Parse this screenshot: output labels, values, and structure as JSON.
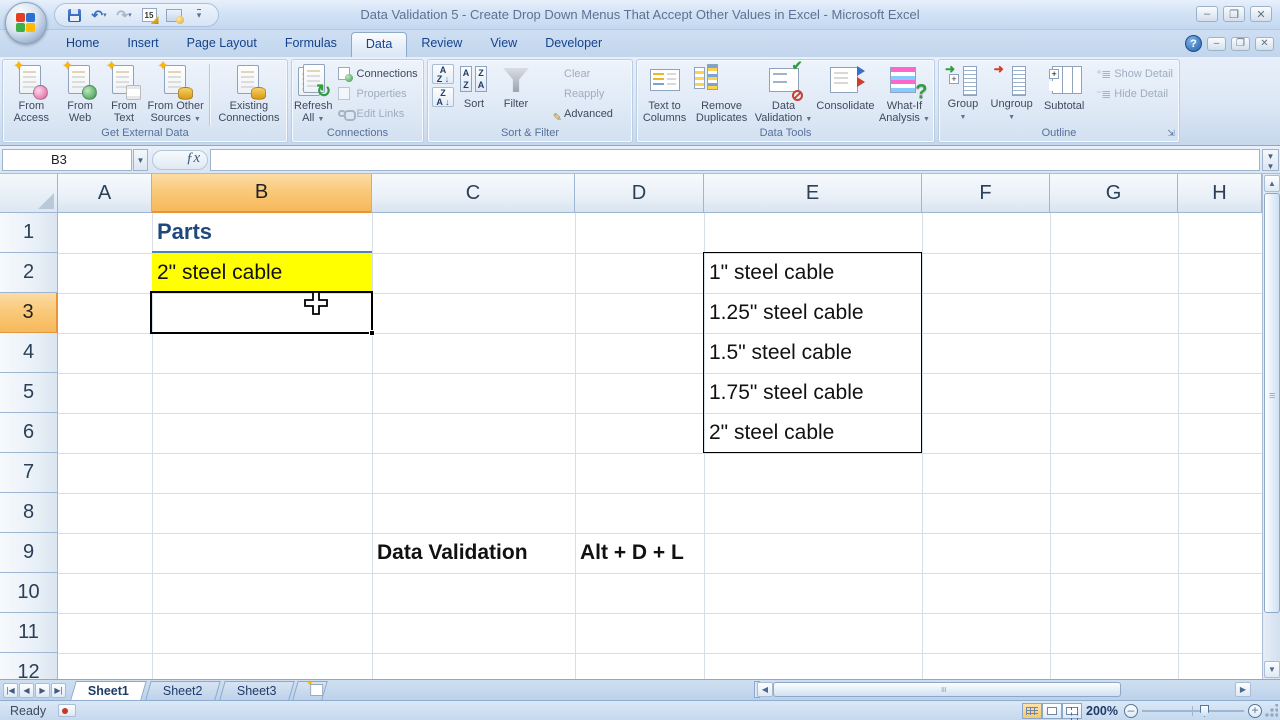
{
  "title_bar": {
    "title": "Data Validation 5 - Create Drop Down Menus That Accept Other Values in Excel - Microsoft Excel",
    "quick_access_icons": [
      "office-orb",
      "save",
      "undo",
      "redo",
      "autoformat",
      "table-style",
      "customize"
    ]
  },
  "ribbon_tabs": {
    "items": [
      "Home",
      "Insert",
      "Page Layout",
      "Formulas",
      "Data",
      "Review",
      "View",
      "Developer"
    ],
    "active": "Data"
  },
  "ribbon": {
    "groups": [
      {
        "name": "Get External Data",
        "buttons": [
          "From Access",
          "From Web",
          "From Text",
          "From Other Sources",
          "Existing Connections"
        ]
      },
      {
        "name": "Connections",
        "big_button": "Refresh All",
        "items": [
          "Connections",
          "Properties",
          "Edit Links"
        ],
        "disabled_items": [
          "Properties",
          "Edit Links"
        ]
      },
      {
        "name": "Sort & Filter",
        "big_buttons": [
          "Sort",
          "Filter"
        ],
        "items": [
          "Clear",
          "Reapply",
          "Advanced"
        ],
        "disabled_items": [
          "Clear",
          "Reapply"
        ]
      },
      {
        "name": "Data Tools",
        "buttons": [
          "Text to Columns",
          "Remove Duplicates",
          "Data Validation",
          "Consolidate",
          "What-If Analysis"
        ]
      },
      {
        "name": "Outline",
        "buttons": [
          "Group",
          "Ungroup",
          "Subtotal"
        ],
        "items": [
          "Show Detail",
          "Hide Detail"
        ],
        "disabled_items": [
          "Show Detail",
          "Hide Detail"
        ]
      }
    ]
  },
  "formula_bar": {
    "name_box": "B3",
    "fx_label": "ƒx",
    "input_value": ""
  },
  "grid": {
    "column_headers": [
      "A",
      "B",
      "C",
      "D",
      "E",
      "F",
      "G",
      "H"
    ],
    "row_headers": [
      "1",
      "2",
      "3",
      "4",
      "5",
      "6",
      "7",
      "8",
      "9",
      "10",
      "11",
      "12"
    ],
    "selected_cell": "B3",
    "selected_column": "B",
    "selected_row": "3",
    "cells": [
      {
        "ref": "B1",
        "text": "Parts",
        "style": "heading"
      },
      {
        "ref": "B2",
        "text": "2\" steel cable",
        "style": "yellow"
      },
      {
        "ref": "E2",
        "text": "1\" steel cable",
        "style": "plain"
      },
      {
        "ref": "E3",
        "text": "1.25\" steel cable",
        "style": "plain"
      },
      {
        "ref": "E4",
        "text": "1.5\" steel cable",
        "style": "plain"
      },
      {
        "ref": "E5",
        "text": "1.75\" steel cable",
        "style": "plain"
      },
      {
        "ref": "E6",
        "text": "2\" steel cable",
        "style": "plain"
      },
      {
        "ref": "C9",
        "text": "Data Validation",
        "style": "bold"
      },
      {
        "ref": "D9",
        "text": "Alt + D + L",
        "style": "bold"
      }
    ],
    "bordered_range": "E2:E6"
  },
  "sheet_tabs": {
    "items": [
      "Sheet1",
      "Sheet2",
      "Sheet3"
    ],
    "active": "Sheet1"
  },
  "status_bar": {
    "ready_label": "Ready",
    "zoom_level": "200%",
    "view_buttons": [
      "normal-view",
      "page-layout-view",
      "page-break-preview"
    ]
  },
  "colors": {
    "selected_header": "#F9C673",
    "cell_highlight": "#FFFF00",
    "heading_text": "#1F497D",
    "heading_border": "#4F81BD",
    "selection_border": "#000000",
    "gridline": "#D6DEE8",
    "active_view_button": "#F9C869"
  }
}
